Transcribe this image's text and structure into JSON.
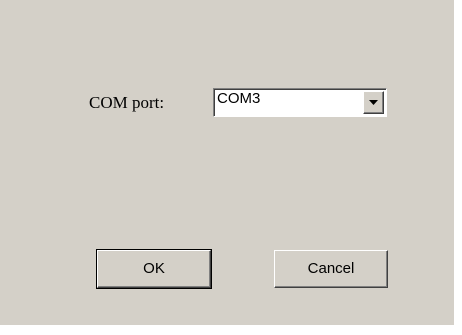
{
  "com_port": {
    "label": "COM port:",
    "selected_value": "COM3"
  },
  "buttons": {
    "ok_label": "OK",
    "cancel_label": "Cancel"
  },
  "colors": {
    "dialog_background": "#d4d0c8"
  }
}
